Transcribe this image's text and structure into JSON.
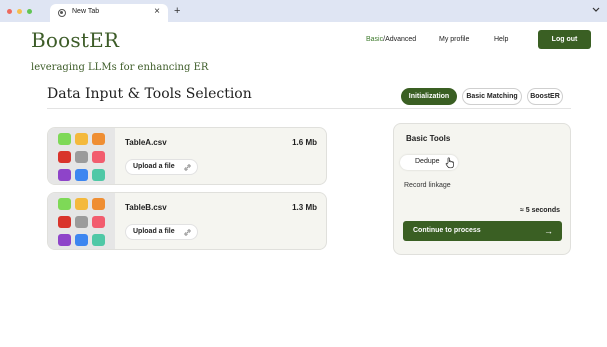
{
  "browser": {
    "tab_title": "New Tab",
    "tab_close": "×",
    "new_tab": "+",
    "traffic_lights": {
      "close": "#ed6a5e",
      "minimize": "#f4bf4f",
      "zoom": "#61c554"
    }
  },
  "header": {
    "brand": "BoostER",
    "tagline": "leveraging LLMs for enhancing ER",
    "nav": {
      "mode_accent": "Basic",
      "mode_rest": "/Advanced",
      "profile": "My profile",
      "help": "Help"
    },
    "logout_label": "Log out"
  },
  "section": {
    "title": "Data Input & Tools Selection",
    "steps": [
      {
        "label": "Initialization",
        "active": true
      },
      {
        "label": "Basic Matching",
        "active": false
      },
      {
        "label": "BoostER",
        "active": false
      }
    ]
  },
  "files": [
    {
      "name": "TableA.csv",
      "size": "1.6 Mb",
      "upload_label": "Upload a file"
    },
    {
      "name": "TableB.csv",
      "size": "1.3 Mb",
      "upload_label": "Upload a file"
    }
  ],
  "thumbnail_colors": [
    "#7ed957",
    "#f4b93c",
    "#ef8e33",
    "#d9342b",
    "#9b9b9b",
    "#f25c6e",
    "#8e44c9",
    "#3d86f0",
    "#4fc8a6"
  ],
  "tools": {
    "title": "Basic Tools",
    "options": [
      {
        "label": "Dedupe",
        "selected": true
      },
      {
        "label": "Record linkage",
        "selected": false
      }
    ],
    "eta": "≈ 5 seconds",
    "continue_label": "Continue to process",
    "continue_arrow": "→"
  },
  "colors": {
    "accent": "#3a5f23",
    "brand_text": "#3d5c28",
    "card_bg": "#f5f5f0"
  },
  "icons": [
    "tab-globe-icon",
    "chevron-down-icon",
    "link-icon",
    "hand-cursor-icon",
    "arrow-right-icon"
  ]
}
